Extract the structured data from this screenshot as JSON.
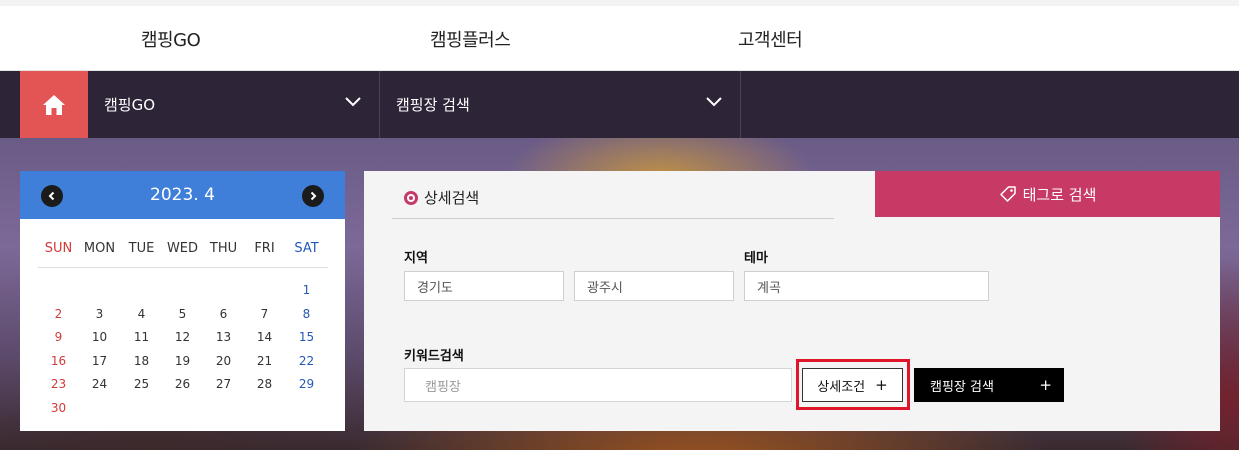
{
  "top_nav": [
    "캠핑GO",
    "캠핑플러스",
    "고객센터"
  ],
  "location_bar": {
    "menu1": "캠핑GO",
    "menu2": "캠핑장 검색",
    "home_color": "#e35454",
    "bar_color": "#2e2438"
  },
  "calendar": {
    "title": "2023. 4",
    "weekdays": [
      "SUN",
      "MON",
      "TUE",
      "WED",
      "THU",
      "FRI",
      "SAT"
    ],
    "weeks": [
      [
        "",
        "",
        "",
        "",
        "",
        "",
        "1"
      ],
      [
        "2",
        "3",
        "4",
        "5",
        "6",
        "7",
        "8"
      ],
      [
        "9",
        "10",
        "11",
        "12",
        "13",
        "14",
        "15"
      ],
      [
        "16",
        "17",
        "18",
        "19",
        "20",
        "21",
        "22"
      ],
      [
        "23",
        "24",
        "25",
        "26",
        "27",
        "28",
        "29"
      ],
      [
        "30",
        "",
        "",
        "",
        "",
        "",
        ""
      ]
    ],
    "header_color": "#3f7fd9"
  },
  "search": {
    "detail_tab": "상세검색",
    "tag_tab": "태그로 검색",
    "region_label": "지역",
    "region_province": "경기도",
    "region_city": "광주시",
    "theme_label": "테마",
    "theme_value": "계곡",
    "keyword_label": "키워드검색",
    "keyword_placeholder": "캠핑장",
    "detail_button": "상세조건",
    "search_button": "캠핑장 검색",
    "plus": "+",
    "accent_color": "#c83a66"
  }
}
